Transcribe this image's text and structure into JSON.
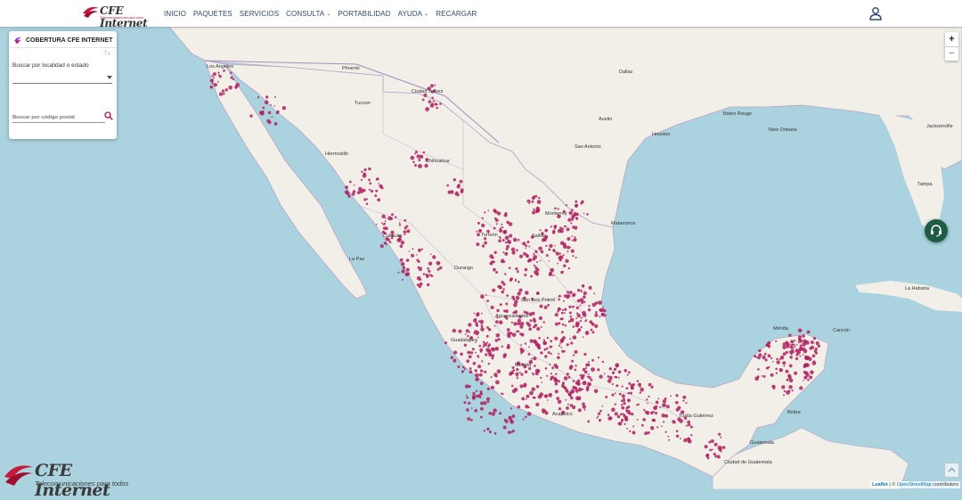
{
  "header": {
    "logo_word": "CFE Internet",
    "logo_tagline": "Telecomunicaciones para todos",
    "nav": [
      {
        "label": "INICIO",
        "dropdown": false
      },
      {
        "label": "PAQUETES",
        "dropdown": false
      },
      {
        "label": "SERVICIOS",
        "dropdown": false
      },
      {
        "label": "CONSULTA",
        "dropdown": true
      },
      {
        "label": "PORTABILIDAD",
        "dropdown": false
      },
      {
        "label": "AYUDA",
        "dropdown": true
      },
      {
        "label": "RECARGAR",
        "dropdown": false
      }
    ],
    "user_icon": "user-icon"
  },
  "panel": {
    "title": "COBERTURA CFE INTERNET",
    "clear_label": "Tx",
    "locality_label": "Buscar por localidad o estado",
    "locality_value": "",
    "postal_placeholder": "Buscar por código postal",
    "postal_value": ""
  },
  "zoom": {
    "in": "+",
    "out": "−"
  },
  "attribution": {
    "leaflet": "Leaflet",
    "sep": " | © ",
    "osm": "OpenStreetMap",
    "tail": " contributors"
  },
  "brand": {
    "word": "CFE Internet",
    "tagline": "Telecomunicaciones para todos"
  },
  "map_labels": [
    {
      "text": "Los Angeles"
    },
    {
      "text": "Phoenix"
    },
    {
      "text": "Tucson"
    },
    {
      "text": "Ciudad Juárez"
    },
    {
      "text": "Hermosillo"
    },
    {
      "text": "Chihuahua"
    },
    {
      "text": "Monterrey"
    },
    {
      "text": "Saltillo"
    },
    {
      "text": "Torreón"
    },
    {
      "text": "Durango"
    },
    {
      "text": "Culiacán"
    },
    {
      "text": "La Paz"
    },
    {
      "text": "San Antonio"
    },
    {
      "text": "Austin"
    },
    {
      "text": "Houston"
    },
    {
      "text": "Dallas"
    },
    {
      "text": "Baton Rouge"
    },
    {
      "text": "New Orleans"
    },
    {
      "text": "Jacksonville"
    },
    {
      "text": "Tampa"
    },
    {
      "text": "Matamoros"
    },
    {
      "text": "San Luis Potosí"
    },
    {
      "text": "Aguascalientes"
    },
    {
      "text": "Guadalajara"
    },
    {
      "text": "Morelia"
    },
    {
      "text": "Acapulco"
    },
    {
      "text": "Mérida"
    },
    {
      "text": "Cancún"
    },
    {
      "text": "La Habana"
    },
    {
      "text": "Belize"
    },
    {
      "text": "Ciudad de Guatemala"
    },
    {
      "text": "Tuxtla Gutiérrez"
    },
    {
      "text": "Guatemala"
    }
  ],
  "colors": {
    "coverage": "#b0205f",
    "ocean": "#aad3df",
    "land": "#f2efe9",
    "chat": "#1e5c46"
  }
}
